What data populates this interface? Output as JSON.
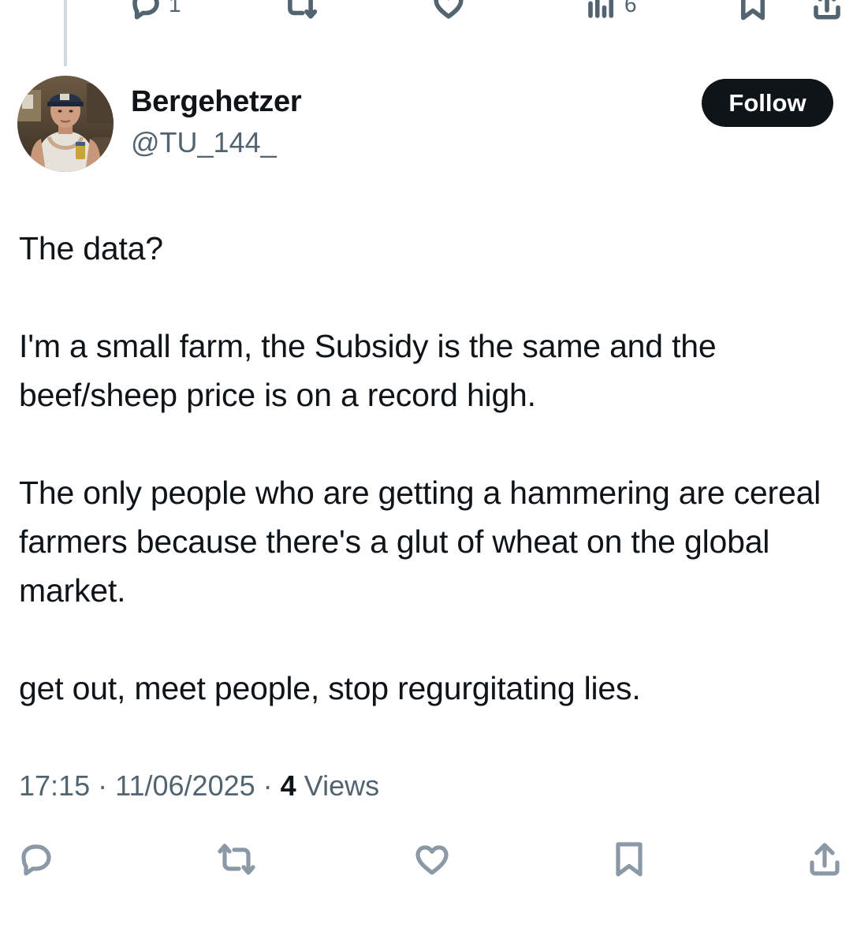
{
  "previous_tweet_actions": {
    "reply_count": "1",
    "views_count": "6"
  },
  "author": {
    "name": "Bergehetzer",
    "handle": "@TU_144_"
  },
  "follow_button": {
    "label": "Follow"
  },
  "tweet": {
    "paragraphs": [
      "The data?",
      "I'm a small farm, the Subsidy is the same and the beef/sheep price is on a record high.",
      "The only people who are getting a hammering are cereal farmers because there's a glut of wheat on the global market.",
      "get out, meet people, stop regurgitating lies."
    ]
  },
  "meta": {
    "time": "17:15",
    "separator": "·",
    "date": "11/06/2025",
    "views_count": "4",
    "views_label": "Views"
  },
  "icons": {
    "reply": "reply-icon",
    "retweet": "retweet-icon",
    "like": "heart-icon",
    "bookmark": "bookmark-icon",
    "share": "share-icon",
    "analytics": "analytics-icon"
  },
  "colors": {
    "text": "#0f1419",
    "secondary": "#536471",
    "icon_gray": "#8b98a5",
    "thread_line": "#cfd9de",
    "follow_bg": "#0f1419"
  }
}
